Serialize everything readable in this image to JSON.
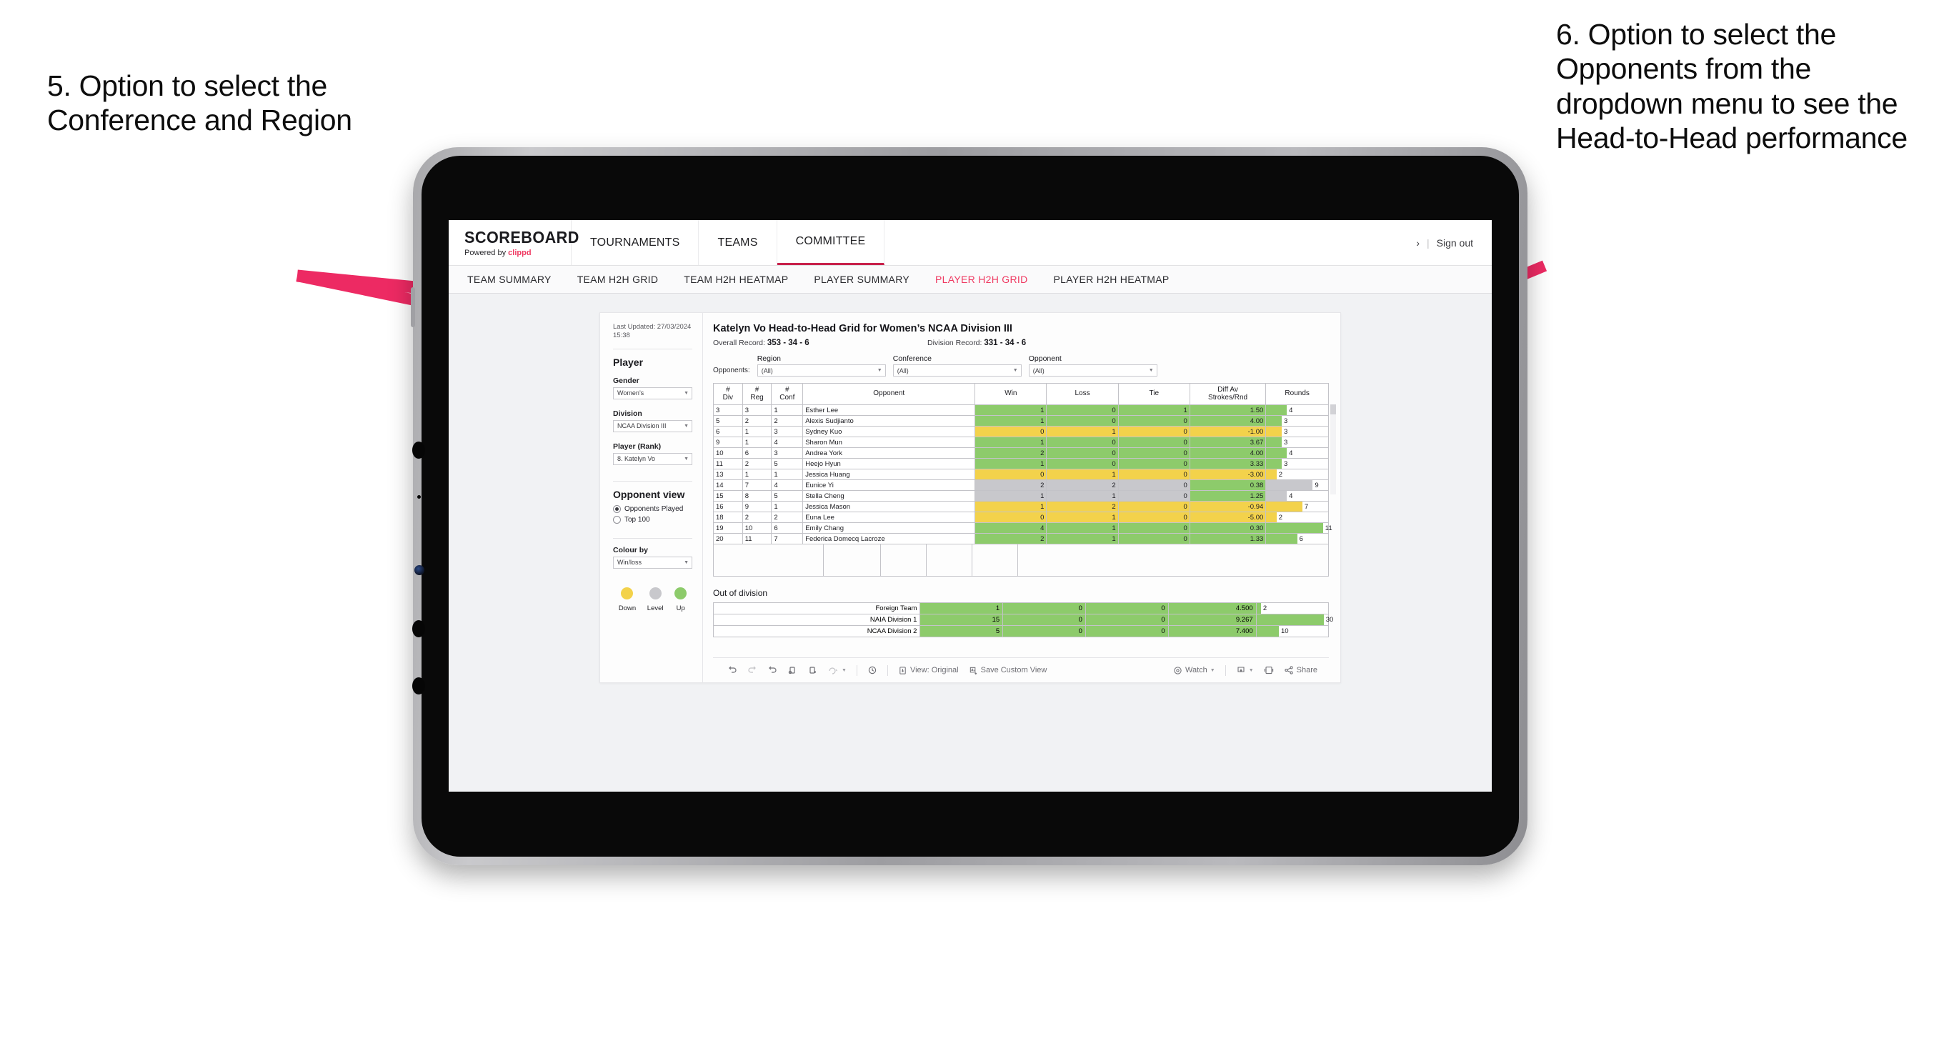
{
  "annotations": {
    "left": "5. Option to select the Conference and Region",
    "right": "6. Option to select the Opponents from the dropdown menu to see the Head-to-Head performance",
    "arrow_color": "#ED2A63"
  },
  "app": {
    "brand": {
      "title": "SCOREBOARD",
      "powered_prefix": "Powered by ",
      "powered_brand": "clippd"
    },
    "topnav": [
      {
        "label": "TOURNAMENTS",
        "active": false
      },
      {
        "label": "TEAMS",
        "active": false
      },
      {
        "label": "COMMITTEE",
        "active": true
      }
    ],
    "topbar_right": {
      "chevron": "›",
      "separator": "|",
      "sign_out": "Sign out"
    },
    "subnav": [
      {
        "label": "TEAM SUMMARY",
        "active": false
      },
      {
        "label": "TEAM H2H GRID",
        "active": false
      },
      {
        "label": "TEAM H2H HEATMAP",
        "active": false
      },
      {
        "label": "PLAYER SUMMARY",
        "active": false
      },
      {
        "label": "PLAYER H2H GRID",
        "active": true
      },
      {
        "label": "PLAYER H2H HEATMAP",
        "active": false
      }
    ]
  },
  "sidebar": {
    "last_updated": "Last Updated: 27/03/2024 15:38",
    "player_heading": "Player",
    "fields": [
      {
        "label": "Gender",
        "value": "Women’s"
      },
      {
        "label": "Division",
        "value": "NCAA Division III"
      },
      {
        "label": "Player (Rank)",
        "value": "8. Katelyn Vo"
      }
    ],
    "opponent_view": {
      "heading": "Opponent view",
      "options": [
        {
          "label": "Opponents Played",
          "selected": true
        },
        {
          "label": "Top 100",
          "selected": false
        }
      ]
    },
    "colour_by": {
      "label": "Colour by",
      "value": "Win/loss"
    },
    "legend": [
      {
        "label": "Down",
        "color": "#F3D24B"
      },
      {
        "label": "Level",
        "color": "#C8C8CC"
      },
      {
        "label": "Up",
        "color": "#8DCB6B"
      }
    ]
  },
  "main": {
    "title": "Katelyn Vo Head-to-Head Grid for Women’s NCAA Division III",
    "overall_record_label": "Overall Record:",
    "overall_record_value": "353 - 34 - 6",
    "division_record_label": "Division Record:",
    "division_record_value": "331 - 34 - 6",
    "filters": {
      "lead_label": "Opponents:",
      "items": [
        {
          "label": "Region",
          "value": "(All)"
        },
        {
          "label": "Conference",
          "value": "(All)"
        },
        {
          "label": "Opponent",
          "value": "(All)"
        }
      ]
    },
    "out_of_division_title": "Out of division"
  },
  "chart_data": {
    "type": "table",
    "title": "Katelyn Vo Head-to-Head Grid for Women’s NCAA Division III",
    "columns": [
      "# Div",
      "# Reg",
      "# Conf",
      "Opponent",
      "Win",
      "Loss",
      "Tie",
      "Diff Av Strokes/Rnd",
      "Rounds"
    ],
    "column_headers_two_line": [
      {
        "l1": "#",
        "l2": "Div"
      },
      {
        "l1": "#",
        "l2": "Reg"
      },
      {
        "l1": "#",
        "l2": "Conf"
      },
      {
        "l1": "Opponent",
        "l2": ""
      },
      {
        "l1": "Win",
        "l2": ""
      },
      {
        "l1": "Loss",
        "l2": ""
      },
      {
        "l1": "Tie",
        "l2": ""
      },
      {
        "l1": "Diff Av",
        "l2": "Strokes/Rnd"
      },
      {
        "l1": "Rounds",
        "l2": ""
      }
    ],
    "colors": {
      "up": "#8DCB6B",
      "down": "#F3D24B",
      "level": "#C8C8CC",
      "none": "#FFFFFF"
    },
    "rounds_max": 12,
    "rows": [
      {
        "div": "3",
        "reg": "3",
        "conf": "1",
        "opponent": "Esther Lee",
        "win": "1",
        "loss": "0",
        "tie": "1",
        "diff": "1.50",
        "rounds": "4",
        "state": "up"
      },
      {
        "div": "5",
        "reg": "2",
        "conf": "2",
        "opponent": "Alexis Sudjianto",
        "win": "1",
        "loss": "0",
        "tie": "0",
        "diff": "4.00",
        "rounds": "3",
        "state": "up"
      },
      {
        "div": "6",
        "reg": "1",
        "conf": "3",
        "opponent": "Sydney Kuo",
        "win": "0",
        "loss": "1",
        "tie": "0",
        "diff": "-1.00",
        "rounds": "3",
        "state": "down"
      },
      {
        "div": "9",
        "reg": "1",
        "conf": "4",
        "opponent": "Sharon Mun",
        "win": "1",
        "loss": "0",
        "tie": "0",
        "diff": "3.67",
        "rounds": "3",
        "state": "up"
      },
      {
        "div": "10",
        "reg": "6",
        "conf": "3",
        "opponent": "Andrea York",
        "win": "2",
        "loss": "0",
        "tie": "0",
        "diff": "4.00",
        "rounds": "4",
        "state": "up"
      },
      {
        "div": "11",
        "reg": "2",
        "conf": "5",
        "opponent": "Heejo Hyun",
        "win": "1",
        "loss": "0",
        "tie": "0",
        "diff": "3.33",
        "rounds": "3",
        "state": "up"
      },
      {
        "div": "13",
        "reg": "1",
        "conf": "1",
        "opponent": "Jessica Huang",
        "win": "0",
        "loss": "1",
        "tie": "0",
        "diff": "-3.00",
        "rounds": "2",
        "state": "down"
      },
      {
        "div": "14",
        "reg": "7",
        "conf": "4",
        "opponent": "Eunice Yi",
        "win": "2",
        "loss": "2",
        "tie": "0",
        "diff": "0.38",
        "rounds": "9",
        "state": "level",
        "diff_state": "up"
      },
      {
        "div": "15",
        "reg": "8",
        "conf": "5",
        "opponent": "Stella Cheng",
        "win": "1",
        "loss": "1",
        "tie": "0",
        "diff": "1.25",
        "rounds": "4",
        "state": "level",
        "diff_state": "up"
      },
      {
        "div": "16",
        "reg": "9",
        "conf": "1",
        "opponent": "Jessica Mason",
        "win": "1",
        "loss": "2",
        "tie": "0",
        "diff": "-0.94",
        "rounds": "7",
        "state": "down"
      },
      {
        "div": "18",
        "reg": "2",
        "conf": "2",
        "opponent": "Euna Lee",
        "win": "0",
        "loss": "1",
        "tie": "0",
        "diff": "-5.00",
        "rounds": "2",
        "state": "down"
      },
      {
        "div": "19",
        "reg": "10",
        "conf": "6",
        "opponent": "Emily Chang",
        "win": "4",
        "loss": "1",
        "tie": "0",
        "diff": "0.30",
        "rounds": "11",
        "state": "up"
      },
      {
        "div": "20",
        "reg": "11",
        "conf": "7",
        "opponent": "Federica Domecq Lacroze",
        "win": "2",
        "loss": "1",
        "tie": "0",
        "diff": "1.33",
        "rounds": "6",
        "state": "up"
      }
    ],
    "out_of_division": {
      "rounds_max": 32,
      "rows": [
        {
          "label": "Foreign Team",
          "win": "1",
          "loss": "0",
          "tie": "0",
          "diff": "4.500",
          "rounds": "2",
          "state": "up"
        },
        {
          "label": "NAIA Division 1",
          "win": "15",
          "loss": "0",
          "tie": "0",
          "diff": "9.267",
          "rounds": "30",
          "state": "up"
        },
        {
          "label": "NCAA Division 2",
          "win": "5",
          "loss": "0",
          "tie": "0",
          "diff": "7.400",
          "rounds": "10",
          "state": "up"
        }
      ]
    }
  },
  "toolbar": {
    "items": [
      {
        "name": "undo",
        "label": ""
      },
      {
        "name": "redo",
        "label": ""
      },
      {
        "name": "revert",
        "label": ""
      },
      {
        "name": "refresh",
        "label": ""
      },
      {
        "name": "pause",
        "label": ""
      },
      {
        "name": "reset",
        "label": ""
      },
      {
        "name": "history",
        "label": ""
      },
      {
        "name": "view-original",
        "label": "View: Original"
      },
      {
        "name": "save-custom-view",
        "label": "Save Custom View"
      },
      {
        "name": "watch",
        "label": "Watch"
      },
      {
        "name": "download",
        "label": ""
      },
      {
        "name": "fullscreen",
        "label": ""
      },
      {
        "name": "share",
        "label": "Share"
      }
    ]
  }
}
